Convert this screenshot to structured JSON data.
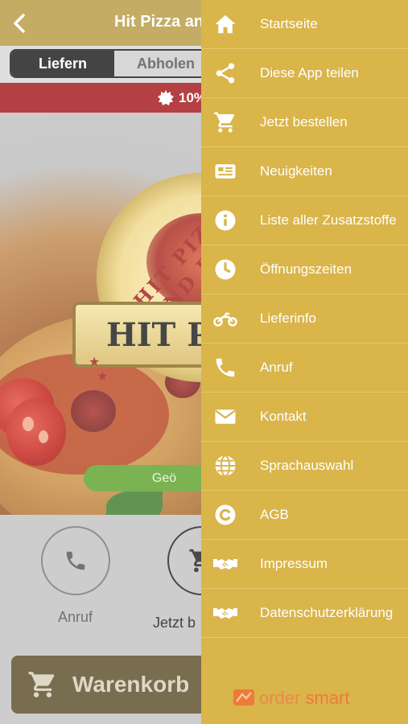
{
  "header": {
    "title": "Hit Pizza and"
  },
  "order_mode": {
    "options": [
      "Liefern",
      "Abholen"
    ],
    "selected": "Liefern"
  },
  "promo": {
    "text": "10%"
  },
  "hero": {
    "logo_ring_text": "HIT PIZZA UND B",
    "logo_banner_text": "HIT P",
    "green_button_text": "Geö"
  },
  "actions": [
    {
      "label": "Anruf",
      "icon": "phone-icon"
    },
    {
      "label": "Jetzt b",
      "icon": "cart-icon"
    }
  ],
  "cart": {
    "label": "Warenkorb"
  },
  "drawer": {
    "items": [
      {
        "label": "Startseite",
        "icon": "home-icon"
      },
      {
        "label": "Diese App teilen",
        "icon": "share-icon"
      },
      {
        "label": "Jetzt bestellen",
        "icon": "cart-icon"
      },
      {
        "label": "Neuigkeiten",
        "icon": "newspaper-icon"
      },
      {
        "label": "Liste aller Zusatzstoffe",
        "icon": "info-icon"
      },
      {
        "label": "Öffnungszeiten",
        "icon": "clock-icon"
      },
      {
        "label": "Lieferinfo",
        "icon": "motorcycle-icon"
      },
      {
        "label": "Anruf",
        "icon": "phone-icon"
      },
      {
        "label": "Kontakt",
        "icon": "envelope-icon"
      },
      {
        "label": "Sprachauswahl",
        "icon": "globe-icon"
      },
      {
        "label": "AGB",
        "icon": "copyright-icon"
      },
      {
        "label": "Impressum",
        "icon": "handshake-icon"
      },
      {
        "label": "Datenschutzerklärung",
        "icon": "handshake-icon"
      }
    ],
    "brand": {
      "text_light": "order",
      "text_strong": "smart"
    }
  },
  "colors": {
    "header": "#b89a42",
    "drawer": "#d9b54a",
    "promo": "#a5161a",
    "cart_bar": "#5c4e2a",
    "brand": "#ee7a3a"
  }
}
